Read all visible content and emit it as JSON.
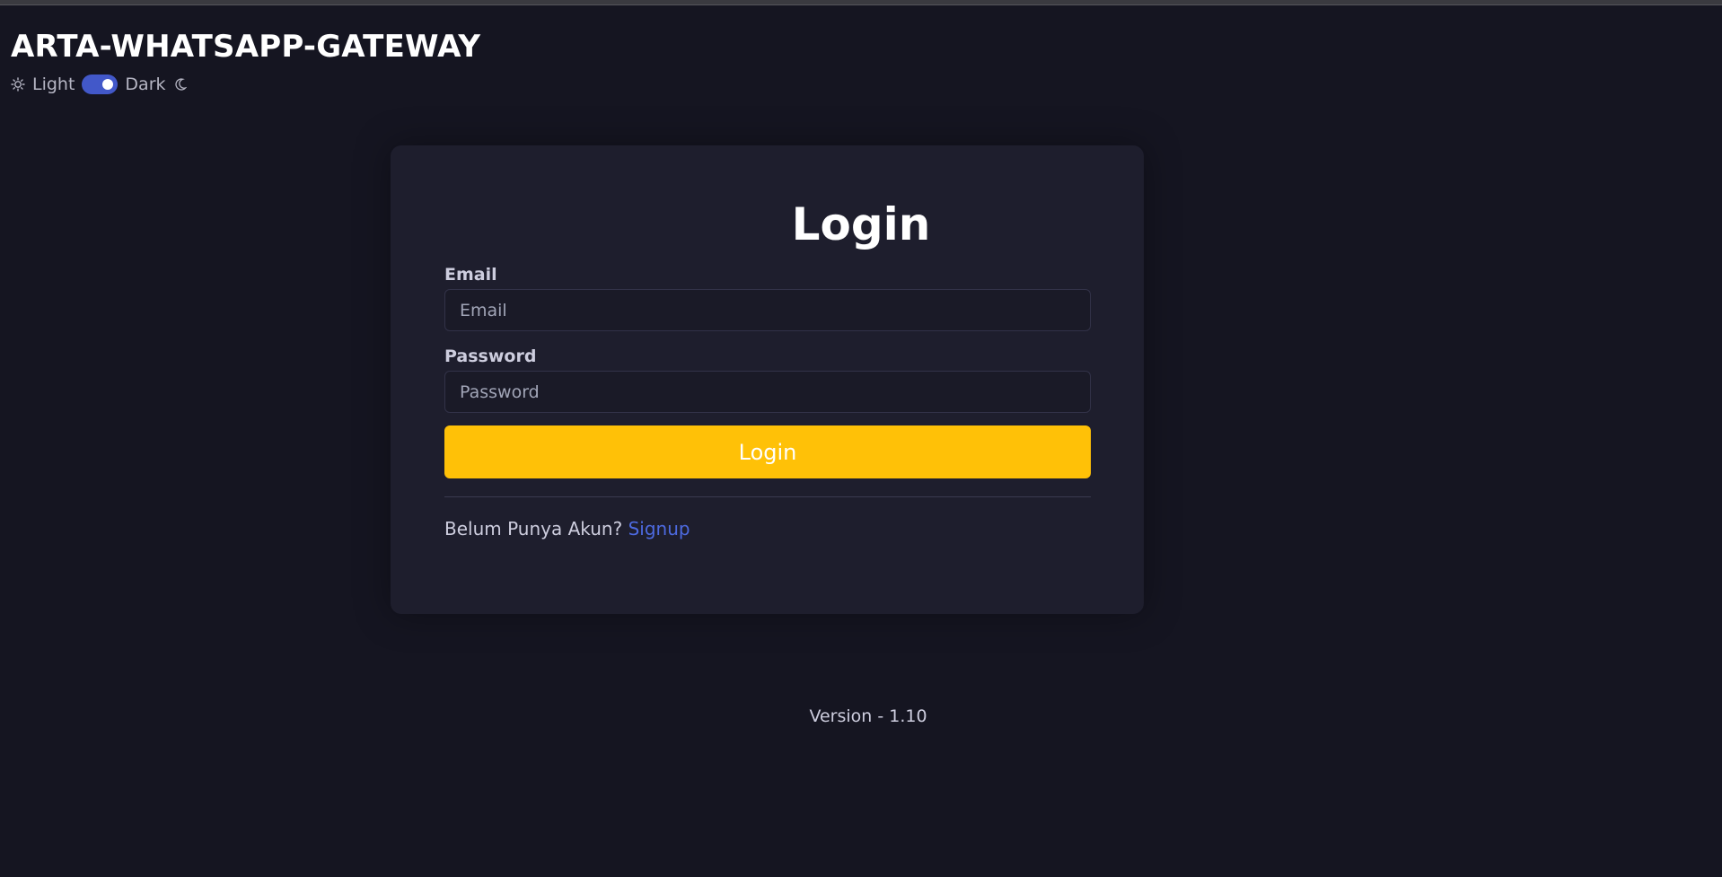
{
  "app": {
    "title": "ARTA-WHATSAPP-GATEWAY"
  },
  "theme_switch": {
    "light_label": "Light",
    "dark_label": "Dark",
    "light_icon": "sun-icon",
    "dark_icon": "moon-icon",
    "state": "dark"
  },
  "login_form": {
    "heading": "Login",
    "email": {
      "label": "Email",
      "placeholder": "Email",
      "value": ""
    },
    "password": {
      "label": "Password",
      "placeholder": "Password",
      "value": ""
    },
    "submit_label": "Login",
    "signup_prompt": "Belum Punya Akun?",
    "signup_link": "Signup"
  },
  "footer": {
    "version": "Version - 1.10"
  },
  "colors": {
    "background": "#151521",
    "card": "#1e1e2d",
    "accent_button": "#ffc107",
    "link": "#4d6ae0",
    "toggle": "#4258c9"
  }
}
